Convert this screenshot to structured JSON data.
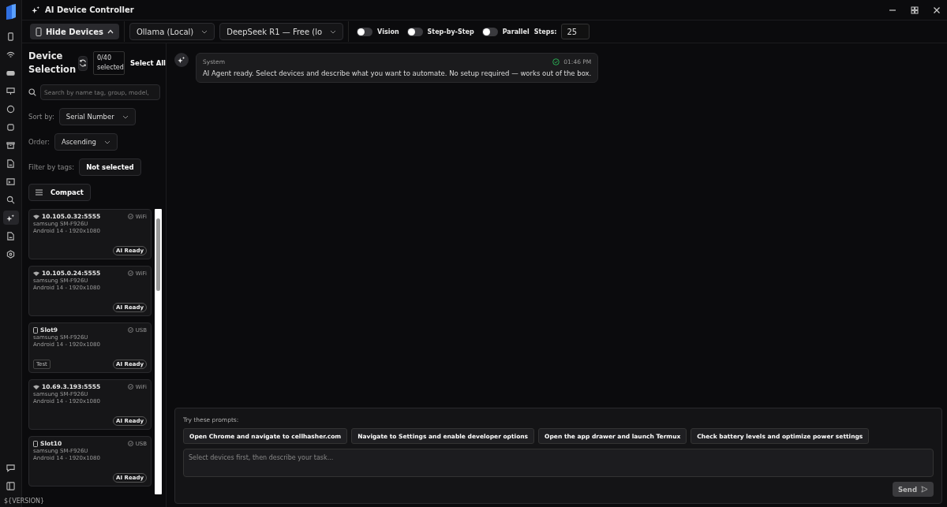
{
  "window": {
    "title": "AI Device Controller"
  },
  "rail": [
    {
      "selected": false
    },
    {
      "selected": false
    },
    {
      "selected": false
    },
    {
      "selected": false
    },
    {
      "selected": false
    },
    {
      "selected": false
    },
    {
      "selected": false
    },
    {
      "selected": false
    },
    {
      "selected": false
    },
    {
      "selected": false
    },
    {
      "selected": true
    },
    {
      "selected": false
    },
    {
      "selected": false
    }
  ],
  "version": "${VERSION}",
  "toolbar": {
    "hide_devices": "Hide Devices",
    "provider": "Ollama (Local)",
    "model": "DeepSeek R1 — Free (lo",
    "toggles": [
      {
        "label": "Vision",
        "on": false
      },
      {
        "label": "Step-by-Step",
        "on": false
      },
      {
        "label": "Parallel",
        "on": false
      }
    ],
    "steps_label": "Steps:",
    "steps": "25"
  },
  "devices_panel": {
    "title": "Device Selection",
    "count": "0/40 selected",
    "select_all": "Select All",
    "search": {
      "placeholder": "Search by name tag, group, model,"
    },
    "sort_label": "Sort by:",
    "sort": "Serial Number",
    "order_label": "Order:",
    "order": "Ascending",
    "filter_label": "Filter by tags:",
    "filter": "Not selected",
    "view": "Compact",
    "devices": [
      {
        "name": "10.105.0.32:5555",
        "kind": "wifi",
        "connection": "WiFi",
        "model": "samsung SM-F926U",
        "os": "Android 14 - 1920x1080",
        "badge": "AI Ready"
      },
      {
        "name": "10.105.0.24:5555",
        "kind": "wifi",
        "connection": "WiFi",
        "model": "samsung SM-F926U",
        "os": "Android 14 - 1920x1080",
        "badge": "AI Ready"
      },
      {
        "name": "Slot9",
        "kind": "usb",
        "connection": "USB",
        "model": "samsung SM-F926U",
        "os": "Android 14 - 1920x1080",
        "tags": [
          "Test"
        ],
        "badge": "AI Ready"
      },
      {
        "name": "10.69.3.193:5555",
        "kind": "wifi",
        "connection": "WiFi",
        "model": "samsung SM-F926U",
        "os": "Android 14 - 1920x1080",
        "badge": "AI Ready"
      },
      {
        "name": "Slot10",
        "kind": "usb",
        "connection": "USB",
        "model": "samsung SM-F926U",
        "os": "Android 14 - 1920x1080",
        "badge": "AI Ready"
      }
    ]
  },
  "messages": [
    {
      "sender": "System",
      "time": "01:46 PM",
      "text": "AI Agent ready. Select devices and describe what you want to automate. No setup required — works out of the box."
    }
  ],
  "composer": {
    "prompts_label": "Try these prompts:",
    "prompts": [
      "Open Chrome and navigate to cellhasher.com",
      "Navigate to Settings and enable developer options",
      "Open the app drawer and launch Termux",
      "Check battery levels and optimize power settings"
    ],
    "placeholder": "Select devices first, then describe your task...",
    "send": "Send"
  }
}
